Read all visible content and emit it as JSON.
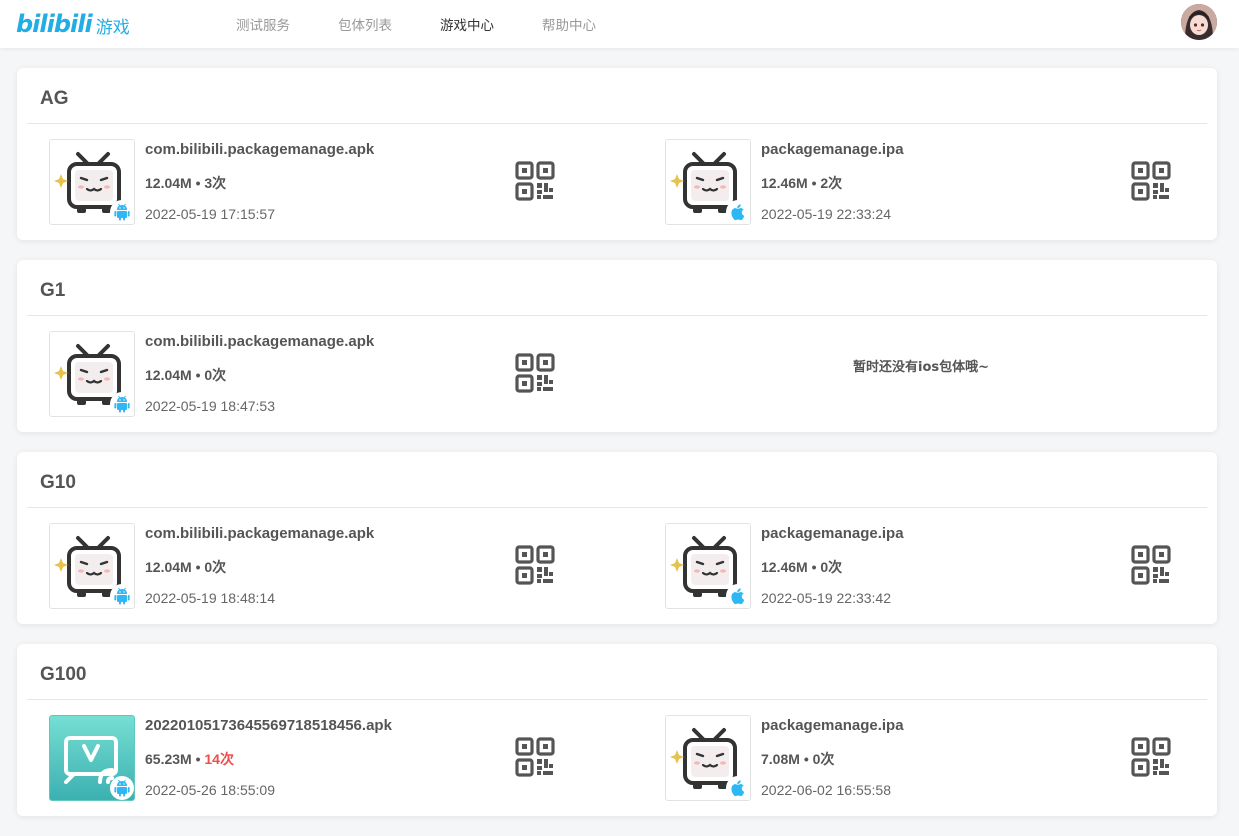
{
  "header": {
    "logo_text": "bilibili",
    "logo_sub": "游戏",
    "nav": [
      {
        "label": "测试服务",
        "active": false
      },
      {
        "label": "包体列表",
        "active": false
      },
      {
        "label": "游戏中心",
        "active": true
      },
      {
        "label": "帮助中心",
        "active": false
      }
    ],
    "avatar_icon": "user-avatar"
  },
  "groups": [
    {
      "title": "AG",
      "android": {
        "name": "com.bilibili.packagemanage.apk",
        "size": "12.04M",
        "count": "3次",
        "date": "2022-05-19 17:15:57",
        "icon": "bilibili-tv-icon"
      },
      "ios": {
        "name": "packagemanage.ipa",
        "size": "12.46M",
        "count": "2次",
        "date": "2022-05-19 22:33:24",
        "icon": "bilibili-tv-icon"
      }
    },
    {
      "title": "G1",
      "android": {
        "name": "com.bilibili.packagemanage.apk",
        "size": "12.04M",
        "count": "0次",
        "date": "2022-05-19 18:47:53",
        "icon": "bilibili-tv-icon"
      },
      "ios_empty": "暂时还没有ios包体哦~"
    },
    {
      "title": "G10",
      "android": {
        "name": "com.bilibili.packagemanage.apk",
        "size": "12.04M",
        "count": "0次",
        "date": "2022-05-19 18:48:14",
        "icon": "bilibili-tv-icon"
      },
      "ios": {
        "name": "packagemanage.ipa",
        "size": "12.46M",
        "count": "0次",
        "date": "2022-05-19 22:33:42",
        "icon": "bilibili-tv-icon"
      }
    },
    {
      "title": "G100",
      "android": {
        "name": "20220105173645569718518456.apk",
        "size": "65.23M",
        "count": "14次",
        "date": "2022-05-26 18:55:09",
        "icon": "cast-app-icon",
        "count_highlight": true
      },
      "ios": {
        "name": "packagemanage.ipa",
        "size": "7.08M",
        "count": "0次",
        "date": "2022-06-02 16:55:58",
        "icon": "bilibili-tv-icon"
      }
    }
  ],
  "colors": {
    "brand": "#23ade5",
    "android_badge": "#2db7f5",
    "ios_badge": "#2db7f5",
    "highlight_count": "#f04c4c",
    "qr": "#555555"
  },
  "meta_separator": "•"
}
